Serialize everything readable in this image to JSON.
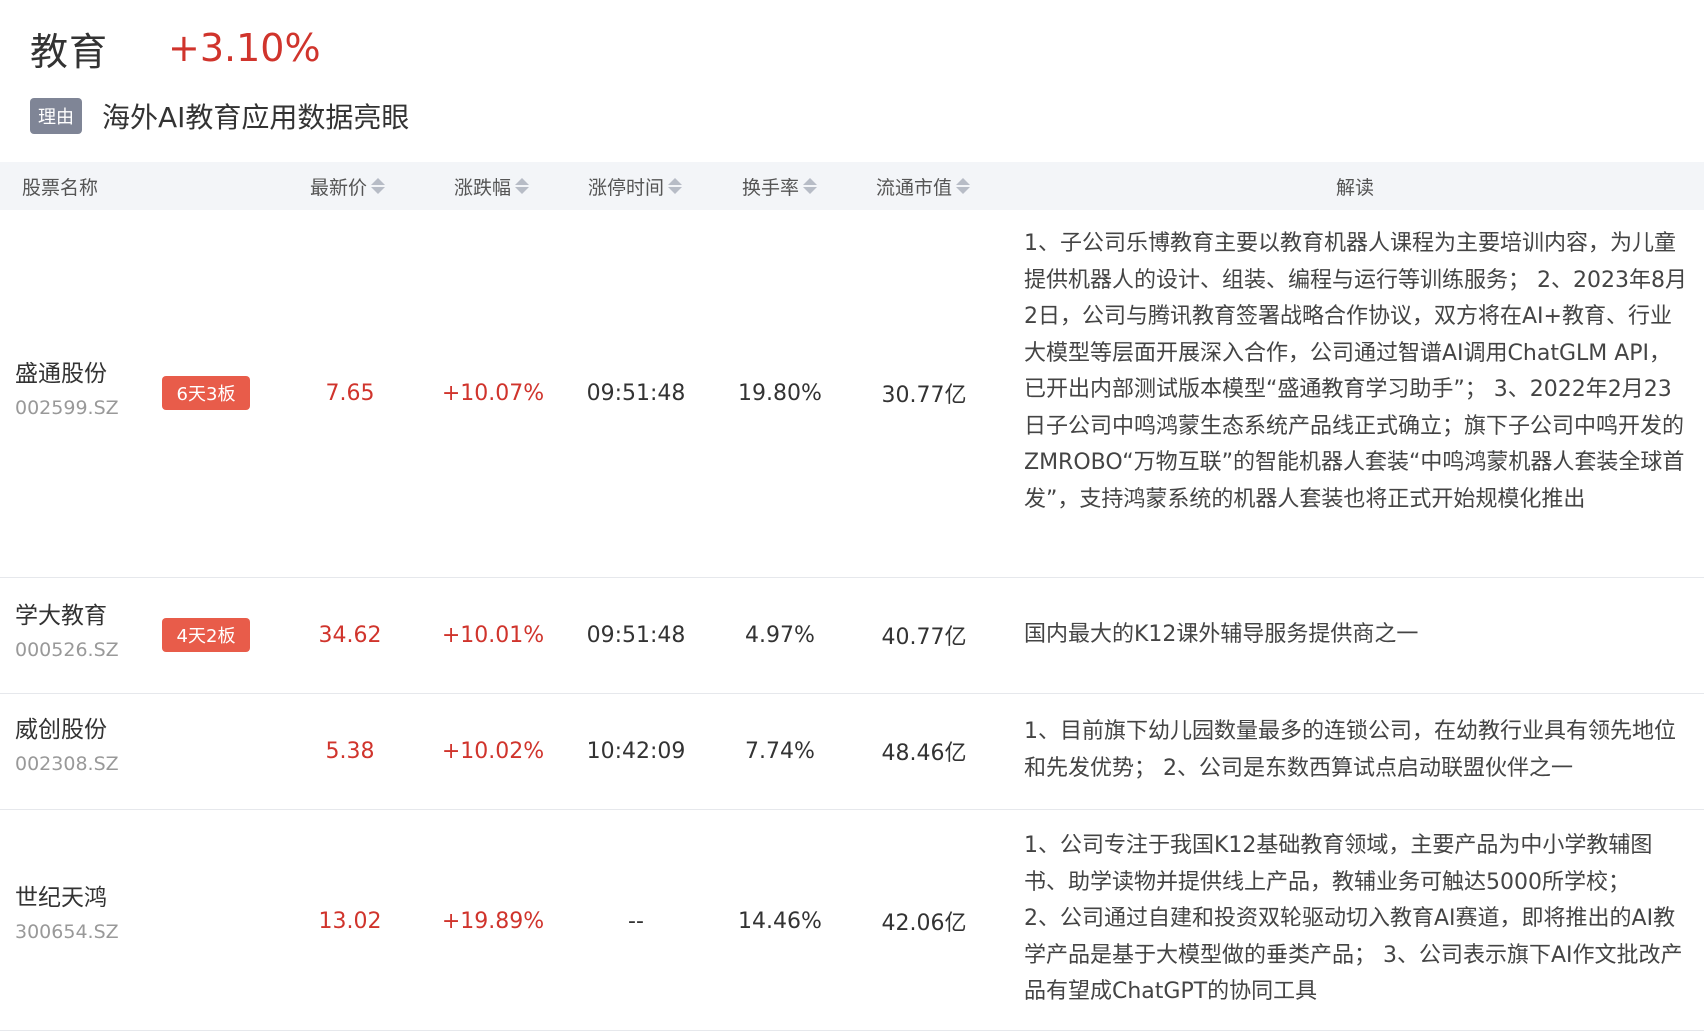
{
  "sector": {
    "name": "教育",
    "change": "+3.10%",
    "reason_tag": "理由",
    "reason_text": "海外AI教育应用数据亮眼"
  },
  "table": {
    "headers": {
      "name": "股票名称",
      "price": "最新价",
      "change": "涨跌幅",
      "limit_time": "涨停时间",
      "turnover": "换手率",
      "market_cap": "流通市值",
      "analysis": "解读"
    },
    "rows": [
      {
        "name": "盛通股份",
        "code": "002599.SZ",
        "badge": "6天3板",
        "price": "7.65",
        "change": "+10.07%",
        "limit_time": "09:51:48",
        "turnover": "19.80%",
        "market_cap": "30.77亿",
        "analysis": "1、子公司乐博教育主要以教育机器人课程为主要培训内容，为儿童提供机器人的设计、组装、编程与运行等训练服务； 2、2023年8月2日，公司与腾讯教育签署战略合作协议，双方将在AI+教育、行业大模型等层面开展深入合作，公司通过智谱AI调用ChatGLM API，已开出内部测试版本模型“盛通教育学习助手”； 3、2022年2月23日子公司中鸣鸿蒙生态系统产品线正式确立；旗下子公司中鸣开发的ZMROBO“万物互联”的智能机器人套装“中鸣鸿蒙机器人套装全球首发”，支持鸿蒙系统的机器人套装也将正式开始规模化推出"
      },
      {
        "name": "学大教育",
        "code": "000526.SZ",
        "badge": "4天2板",
        "price": "34.62",
        "change": "+10.01%",
        "limit_time": "09:51:48",
        "turnover": "4.97%",
        "market_cap": "40.77亿",
        "analysis": "国内最大的K12课外辅导服务提供商之一"
      },
      {
        "name": "威创股份",
        "code": "002308.SZ",
        "badge": "",
        "price": "5.38",
        "change": "+10.02%",
        "limit_time": "10:42:09",
        "turnover": "7.74%",
        "market_cap": "48.46亿",
        "analysis": "1、目前旗下幼儿园数量最多的连锁公司，在幼教行业具有领先地位和先发优势； 2、公司是东数西算试点启动联盟伙伴之一"
      },
      {
        "name": "世纪天鸿",
        "code": "300654.SZ",
        "badge": "",
        "price": "13.02",
        "change": "+19.89%",
        "limit_time": "--",
        "turnover": "14.46%",
        "market_cap": "42.06亿",
        "analysis_lines": [
          "1、公司专注于我国K12基础教育领域，主要产品为中小学教辅图书、助学读物并提供线上产品，教辅业务可触达5000所学校；",
          "2、公司通过自建和投资双轮驱动切入教育AI赛道，即将推出的AI教学产品是基于大模型做的垂类产品； 3、公司表示旗下AI作文批改产品有望成ChatGPT的协同工具"
        ]
      }
    ]
  },
  "colors": {
    "up": "#d0342c",
    "badge": "#e85c4a",
    "reason_tag": "#7f8596",
    "header_bg": "#f3f5f8"
  }
}
